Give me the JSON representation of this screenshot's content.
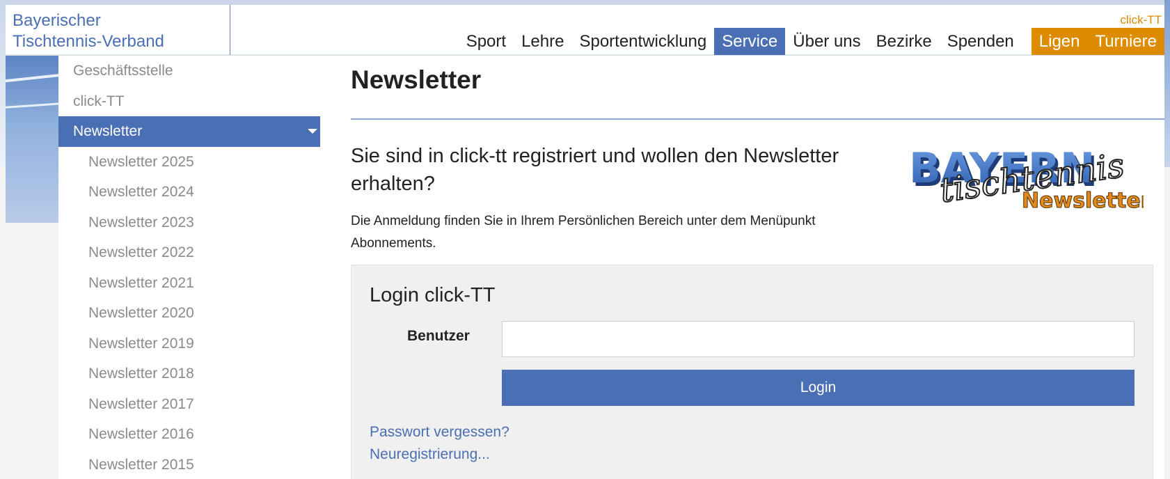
{
  "brand": {
    "line1": "Bayerischer",
    "line2": "Tischtennis-Verband"
  },
  "topbar": {
    "clicktt_link": "click-TT"
  },
  "topnav": {
    "items": [
      "Sport",
      "Lehre",
      "Sportentwicklung",
      "Service",
      "Über uns",
      "Bezirke",
      "Spenden"
    ],
    "active": "Service",
    "highlight_items": [
      "Ligen",
      "Turniere"
    ]
  },
  "sidebar": {
    "items": [
      {
        "label": "Geschäftsstelle"
      },
      {
        "label": "click-TT"
      },
      {
        "label": "Newsletter",
        "active": true
      },
      {
        "label": "Newsletter 2025"
      },
      {
        "label": "Newsletter 2024"
      },
      {
        "label": "Newsletter 2023"
      },
      {
        "label": "Newsletter 2022"
      },
      {
        "label": "Newsletter 2021"
      },
      {
        "label": "Newsletter 2020"
      },
      {
        "label": "Newsletter 2019"
      },
      {
        "label": "Newsletter 2018"
      },
      {
        "label": "Newsletter 2017"
      },
      {
        "label": "Newsletter 2016"
      },
      {
        "label": "Newsletter 2015"
      }
    ]
  },
  "main": {
    "title": "Newsletter",
    "lead": "Sie sind in click-tt registriert und wollen den Newsletter erhalten?",
    "body": "Die Anmeldung finden Sie in Ihrem Persönlichen Bereich unter dem Menüpunkt Abonnements.",
    "logo": {
      "word1": "BAYERN",
      "word2": "tischtennis",
      "word3": "Newsletter"
    }
  },
  "login": {
    "title": "Login click-TT",
    "user_label": "Benutzer",
    "user_value": "",
    "button_label": "Login",
    "forgot_link": "Passwort vergessen?",
    "register_link": "Neuregistrierung..."
  },
  "colors": {
    "brand_blue": "#4a6fb5",
    "accent_orange": "#dd8c00",
    "sidebar_text": "#8a8a8a"
  }
}
